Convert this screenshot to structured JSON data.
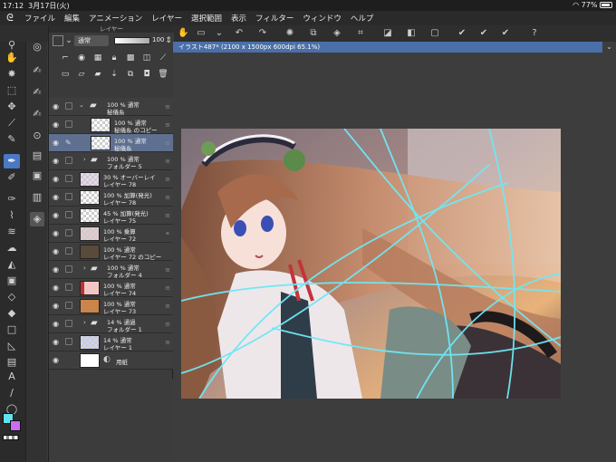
{
  "status_bar": {
    "time": "17:12",
    "date": "3月17日(火)",
    "battery": "77%"
  },
  "menu": {
    "items": [
      "ファイル",
      "編集",
      "アニメーション",
      "レイヤー",
      "選択範囲",
      "表示",
      "フィルター",
      "ウィンドウ",
      "ヘルプ"
    ]
  },
  "layer_panel": {
    "title": "レイヤー",
    "blend_mode": "通常",
    "opacity": "100",
    "layers": [
      {
        "line1": "100 % 通常",
        "line2": "秘儀糸",
        "kind": "folder",
        "selected": false
      },
      {
        "line1": "100 % 通常",
        "line2": "秘儀糸 のコピー",
        "kind": "raster",
        "selected": false
      },
      {
        "line1": "100 % 通常",
        "line2": "秘儀糸",
        "kind": "raster",
        "selected": true
      },
      {
        "line1": "100 % 通常",
        "line2": "フォルダー 5",
        "kind": "folder",
        "selected": false
      },
      {
        "line1": "30 % オーバーレイ",
        "line2": "レイヤー 78",
        "kind": "raster",
        "selected": false
      },
      {
        "line1": "100 % 加算(発光)",
        "line2": "レイヤー 78",
        "kind": "raster",
        "selected": false
      },
      {
        "line1": "45 % 加算(発光)",
        "line2": "レイヤー 75",
        "kind": "raster",
        "selected": false
      },
      {
        "line1": "100 % 乗算",
        "line2": "レイヤー 72",
        "kind": "raster",
        "selected": false
      },
      {
        "line1": "100 % 通常",
        "line2": "レイヤー 72 のコピー",
        "kind": "raster",
        "selected": false
      },
      {
        "line1": "100 % 通常",
        "line2": "フォルダー 4",
        "kind": "folder",
        "selected": false
      },
      {
        "line1": "100 % 通常",
        "line2": "レイヤー 74",
        "kind": "raster",
        "selected": false
      },
      {
        "line1": "100 % 通常",
        "line2": "レイヤー 73",
        "kind": "raster",
        "selected": false
      },
      {
        "line1": "14 % 通過",
        "line2": "フォルダー 1",
        "kind": "folder",
        "selected": false
      },
      {
        "line1": "14 % 通常",
        "line2": "レイヤー 1",
        "kind": "raster",
        "selected": false
      },
      {
        "line1": "用紙",
        "line2": "",
        "kind": "paper",
        "selected": false
      }
    ]
  },
  "document": {
    "tab_label": "イラスト487* (2100 x 1500px 600dpi 65.1%)"
  },
  "colors": {
    "main": "#5fe3f0",
    "sub": "#c76ef2",
    "accent": "#4a78c4",
    "selected_layer": "#5e6f90"
  },
  "icons": {
    "tools": [
      "zoom-icon",
      "hand-icon",
      "magic-wand-icon",
      "select-icon",
      "move-icon",
      "eyedropper-icon",
      "pen-icon",
      "brush-icon",
      "airbrush-icon",
      "ink-pen-icon",
      "pencil-icon",
      "blend-icon",
      "fill-icon",
      "gradient-icon",
      "eraser-icon",
      "shape-icon",
      "ruler-icon",
      "text-icon",
      "line-icon",
      "balloon-icon"
    ]
  }
}
